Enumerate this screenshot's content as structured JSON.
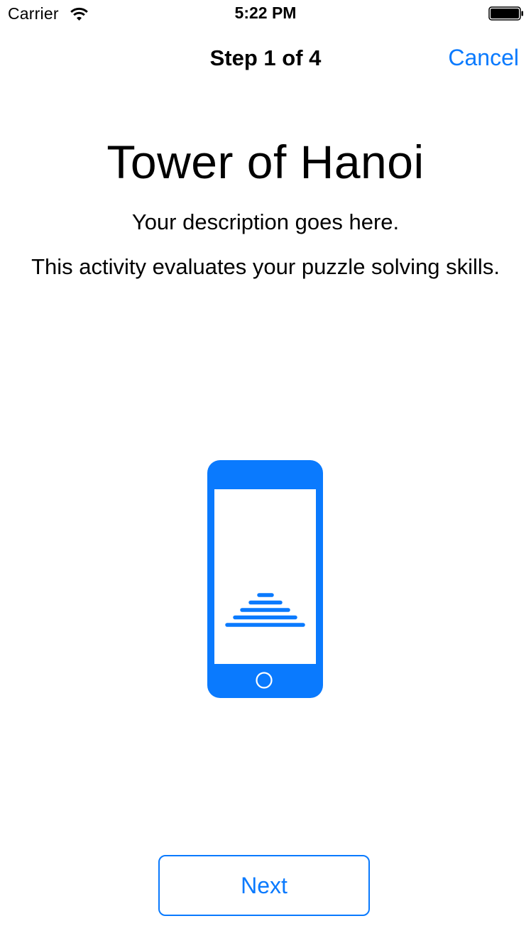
{
  "status_bar": {
    "carrier": "Carrier",
    "time": "5:22 PM"
  },
  "nav": {
    "title": "Step 1 of 4",
    "cancel_label": "Cancel"
  },
  "content": {
    "title": "Tower of Hanoi",
    "description": "Your description goes here.",
    "detail": "This activity evaluates your puzzle solving skills."
  },
  "footer": {
    "next_label": "Next"
  },
  "colors": {
    "accent": "#0a7afe",
    "background": "#ffffff",
    "text": "#000000"
  },
  "icons": [
    "wifi-icon",
    "battery-icon",
    "phone-hanoi-illustration-icon"
  ]
}
